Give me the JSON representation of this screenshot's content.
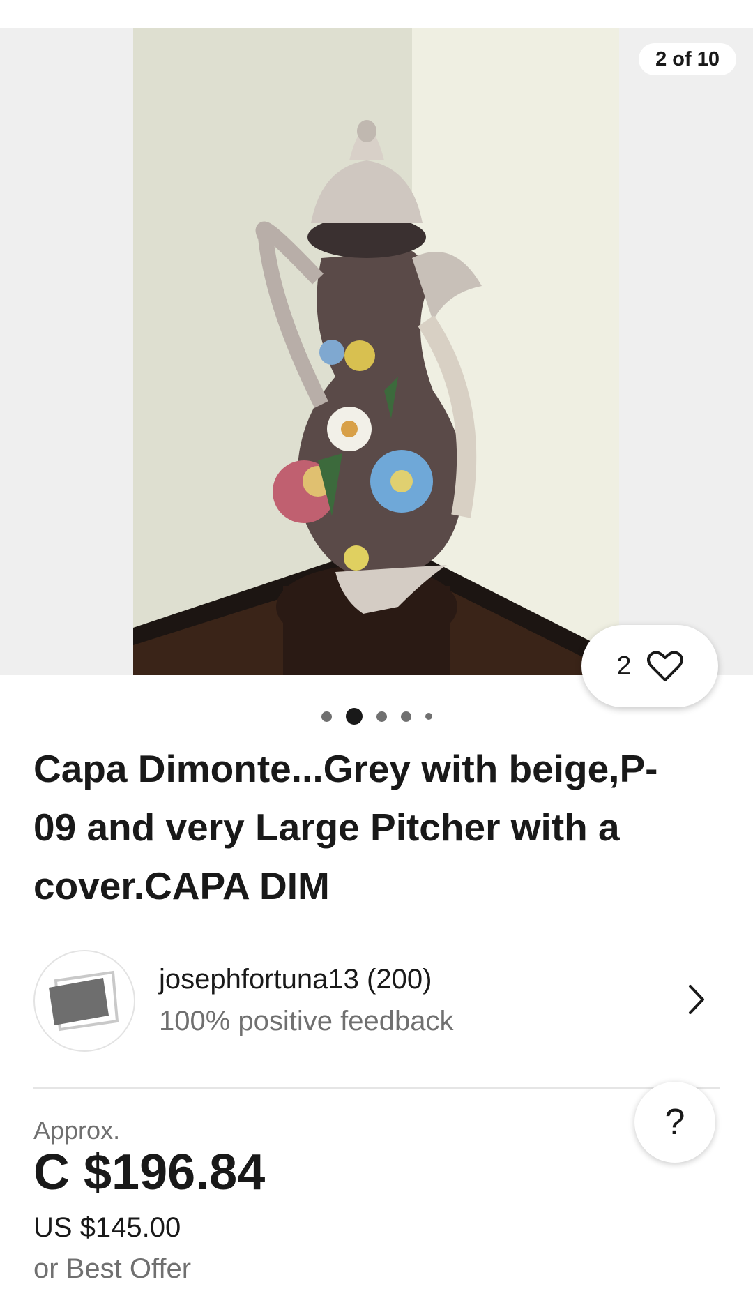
{
  "gallery": {
    "counter": "2 of 10",
    "watch_count": "2",
    "current_index": 2,
    "dots": 5
  },
  "listing": {
    "title": "Capa Dimonte...Grey with beige,P-09 and very Large Pitcher with a cover.CAPA DIM"
  },
  "seller": {
    "name": "josephfortuna13 (200)",
    "feedback": "100% positive feedback"
  },
  "price": {
    "approx_label": "Approx.",
    "converted": "C $196.84",
    "original": "US $145.00",
    "best_offer": "or Best Offer"
  },
  "help": {
    "label": "?"
  },
  "colors": {
    "text": "#191919",
    "muted": "#707070",
    "divider": "#e5e5e5"
  },
  "icons": [
    "heart-icon",
    "chevron-right-icon",
    "help-icon",
    "image-placeholder-icon"
  ]
}
